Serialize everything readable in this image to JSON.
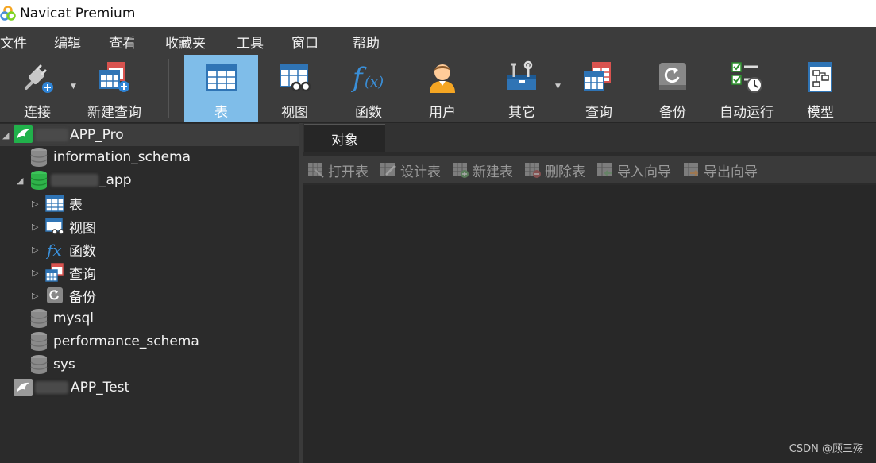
{
  "window": {
    "title": "Navicat Premium"
  },
  "menu": [
    "文件",
    "编辑",
    "查看",
    "收藏夹",
    "工具",
    "窗口",
    "帮助"
  ],
  "toolbar": {
    "connect": "连接",
    "new_query": "新建查询",
    "table": "表",
    "view": "视图",
    "function": "函数",
    "user": "用户",
    "other": "其它",
    "query": "查询",
    "backup": "备份",
    "automation": "自动运行",
    "model": "模型"
  },
  "tree": {
    "conn1_label": "APP_Pro",
    "db_information_schema": "information_schema",
    "db_app": "_app",
    "obj_table": "表",
    "obj_view": "视图",
    "obj_function": "函数",
    "obj_query": "查询",
    "obj_backup": "备份",
    "db_mysql": "mysql",
    "db_performance_schema": "performance_schema",
    "db_sys": "sys",
    "conn2_label": "APP_Test"
  },
  "content": {
    "tab_objects": "对象",
    "actions": {
      "open_table": "打开表",
      "design_table": "设计表",
      "new_table": "新建表",
      "delete_table": "删除表",
      "import_wizard": "导入向导",
      "export_wizard": "导出向导"
    },
    "watermark": "CSDN @顾三殇"
  },
  "colors": {
    "active_tool": "#7fbde9",
    "background": "#2b2b2b",
    "toolbar": "#3c3c3c",
    "connection_green": "#21b14b",
    "db_green": "#2fb34a"
  }
}
